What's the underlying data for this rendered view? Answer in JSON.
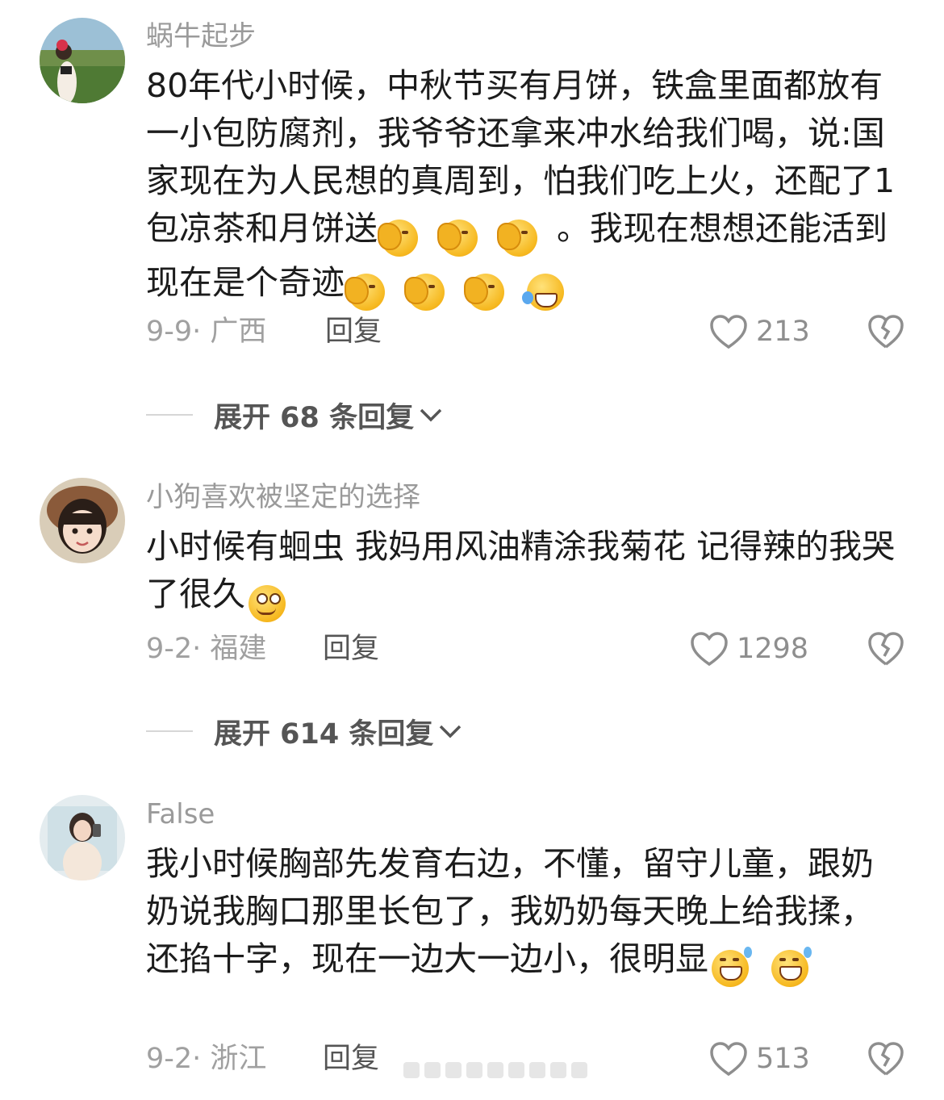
{
  "comments": [
    {
      "username": "蜗牛起步",
      "text": "80年代小时候，中秋节买有月饼，铁盒里面都放有一小包防腐剂，我爷爷还拿来冲水给我们喝，说:国家现在为人民想的真周到，怕我们吃上火，还配了1包凉茶和月饼送",
      "text_after": "。我现在想想还能活到现在是个奇迹",
      "date_location": "9-9· 广西",
      "reply_label": "回复",
      "likes": "213",
      "expand_label": "展开 68 条回复"
    },
    {
      "username": "小狗喜欢被坚定的选择",
      "text": "小时候有蛔虫 我妈用风油精涂我菊花 记得辣的我哭了很久",
      "date_location": "9-2· 福建",
      "reply_label": "回复",
      "likes": "1298",
      "expand_label": "展开 614 条回复"
    },
    {
      "username": "False",
      "text": "我小时候胸部先发育右边，不懂，留守儿童，跟奶奶说我胸口那里长包了，我奶奶每天晚上给我揉，还掐十字，现在一边大一边小，很明显",
      "date_location": "9-2· 浙江",
      "reply_label": "回复",
      "likes": "513"
    }
  ],
  "icons": {
    "like": "heart-outline-icon",
    "dislike": "broken-heart-icon",
    "expand": "chevron-down-icon"
  },
  "colors": {
    "username": "#9a9a9a",
    "text": "#1c1c1c",
    "meta": "#a0a0a0"
  }
}
